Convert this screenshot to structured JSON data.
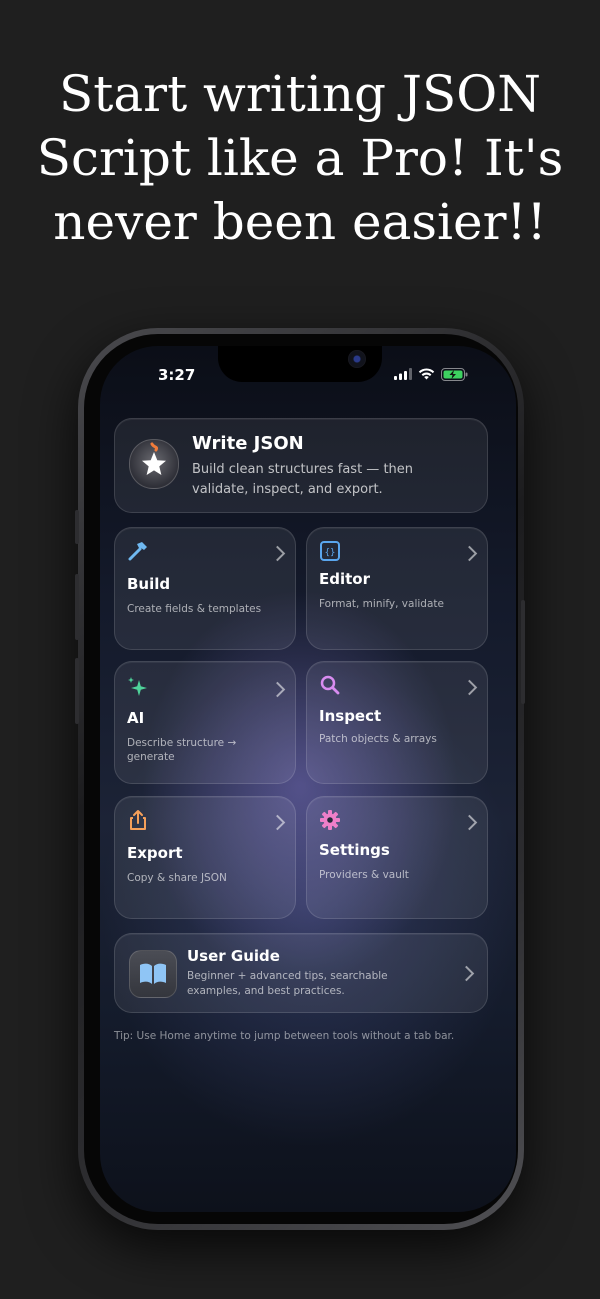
{
  "headline": {
    "line1": "Start writing JSON",
    "line2": "Script like a Pro! It's",
    "line3": "never been easier!!"
  },
  "status_bar": {
    "time": "3:27",
    "icons": [
      "signal-icon",
      "wifi-icon",
      "battery-charging-icon"
    ]
  },
  "hero": {
    "icon": "star-icon",
    "title": "Write JSON",
    "subtitle": "Build clean structures fast — then validate, inspect, and export."
  },
  "tiles": [
    {
      "icon": "hammer-icon",
      "title": "Build",
      "subtitle": "Create fields & templates",
      "color": "#6fb8f0"
    },
    {
      "icon": "braces-icon",
      "title": "Editor",
      "subtitle": "Format, minify, validate",
      "color": "#5aa6ee"
    },
    {
      "icon": "sparkles-icon",
      "title": "AI",
      "subtitle": "Describe structure → generate",
      "color": "#4fd39a"
    },
    {
      "icon": "magnifier-icon",
      "title": "Inspect",
      "subtitle": "Patch objects & arrays",
      "color": "#d88cf0"
    },
    {
      "icon": "share-icon",
      "title": "Export",
      "subtitle": "Copy & share JSON",
      "color": "#f5a05a"
    },
    {
      "icon": "gear-icon",
      "title": "Settings",
      "subtitle": "Providers & vault",
      "color": "#ee7fc9"
    }
  ],
  "guide": {
    "icon": "book-icon",
    "title": "User Guide",
    "subtitle": "Beginner + advanced tips, searchable examples, and best practices."
  },
  "tip": "Tip: Use Home anytime to jump between tools without a tab bar."
}
